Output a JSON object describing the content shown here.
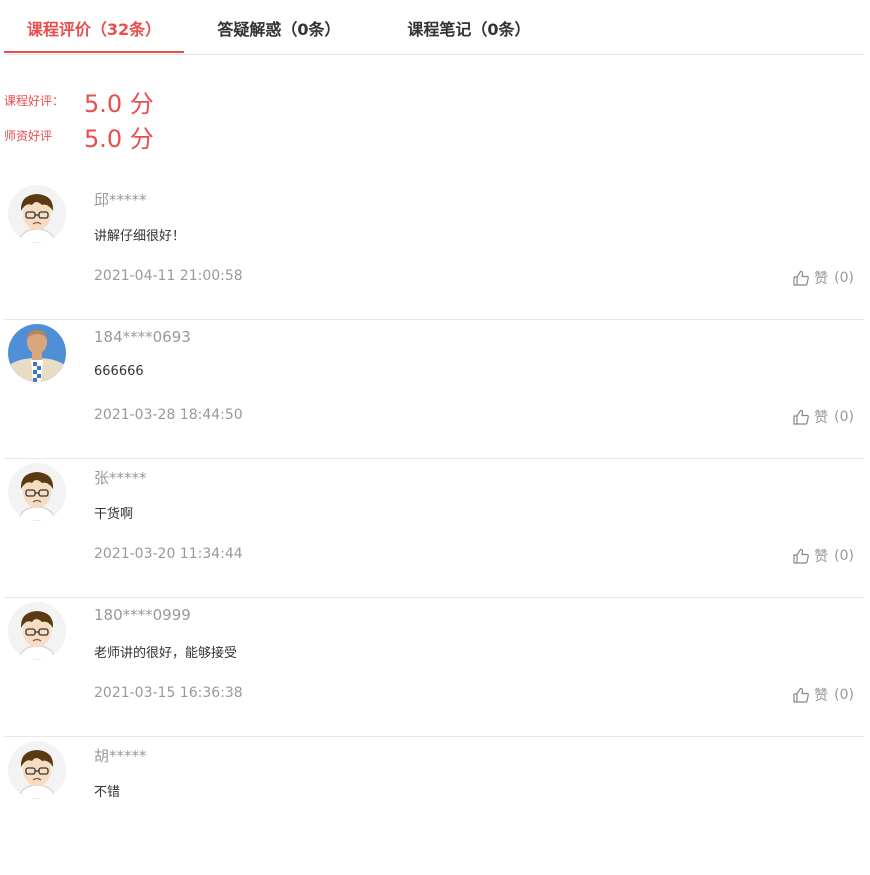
{
  "tabs": [
    {
      "label": "课程评价（32条）",
      "active": true
    },
    {
      "label": "答疑解惑（0条）",
      "active": false
    },
    {
      "label": "课程笔记（0条）",
      "active": false
    }
  ],
  "scores": [
    {
      "label": "课程好评：",
      "value": "5.0 分"
    },
    {
      "label": "师资好评",
      "value": "5.0 分"
    }
  ],
  "reviews": [
    {
      "user": "邱*****",
      "comment": "讲解仔细很好！",
      "time": "2021-04-11 21:00:58",
      "like_label": "赞",
      "like_count": "(0)",
      "avatar": "cartoon-boy-avatar"
    },
    {
      "user": "184****0693",
      "comment": "666666",
      "time": "2021-03-28 18:44:50",
      "like_label": "赞",
      "like_count": "(0)",
      "avatar": "man-blue-avatar"
    },
    {
      "user": "张*****",
      "comment": "干货啊",
      "time": "2021-03-20 11:34:44",
      "like_label": "赞",
      "like_count": "(0)",
      "avatar": "cartoon-boy-avatar"
    },
    {
      "user": "180****0999",
      "comment": "老师讲的很好，能够接受",
      "time": "2021-03-15 16:36:38",
      "like_label": "赞",
      "like_count": "(0)",
      "avatar": "cartoon-boy-avatar"
    },
    {
      "user": "胡*****",
      "comment": "不错",
      "time": "",
      "like_label": "",
      "like_count": "",
      "avatar": "cartoon-boy-avatar"
    }
  ],
  "colors": {
    "accent": "#e84e4e",
    "muted": "#999999",
    "text": "#333333",
    "divider": "#e6e6e6"
  }
}
